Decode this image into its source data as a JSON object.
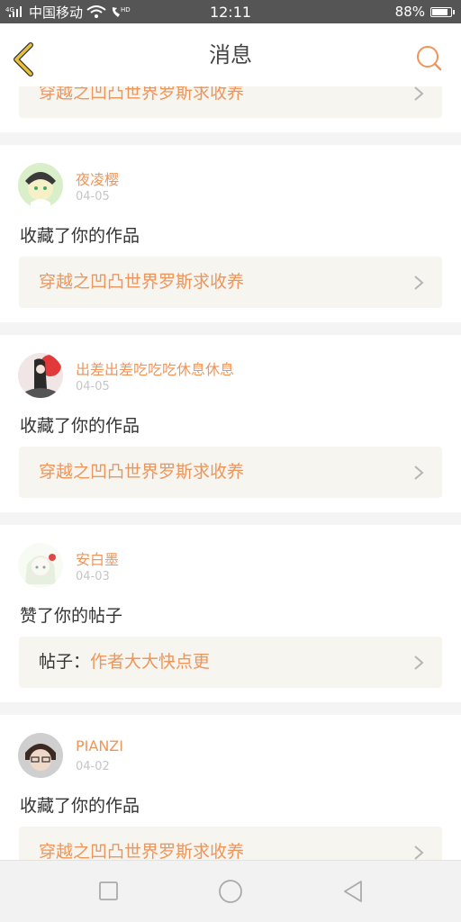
{
  "status": {
    "carrier": "中国移动",
    "time": "12:11",
    "battery": "88%",
    "battery_level": 0.88,
    "signal_prefix": "4G",
    "hd": "HD"
  },
  "header": {
    "title": "消息"
  },
  "partial_card": {
    "link_text": "穿越之凹凸世界罗斯求收养"
  },
  "messages": [
    {
      "username": "夜凌樱",
      "date": "04-05",
      "action": "收藏了你的作品",
      "link_prefix": "",
      "link_text": "穿越之凹凸世界罗斯求收养"
    },
    {
      "username": "出差出差吃吃吃休息休息",
      "date": "04-05",
      "action": "收藏了你的作品",
      "link_prefix": "",
      "link_text": "穿越之凹凸世界罗斯求收养"
    },
    {
      "username": "安白墨",
      "date": "04-03",
      "action": "赞了你的帖子",
      "link_prefix": "帖子：",
      "link_text": "作者大大快点更"
    },
    {
      "username": "PIANZI",
      "date": "04-02",
      "action": "收藏了你的作品",
      "link_prefix": "",
      "link_text": "穿越之凹凸世界罗斯求收养"
    }
  ],
  "colors": {
    "accent": "#f0955a",
    "back_icon": "#e8c13a",
    "link_bg": "#f6f5ef"
  },
  "icons": {
    "back": "chevron-left-icon",
    "search": "search-icon",
    "row_arrow": "chevron-right-icon",
    "nav_recent": "square-icon",
    "nav_home": "circle-icon",
    "nav_back": "triangle-back-icon"
  }
}
